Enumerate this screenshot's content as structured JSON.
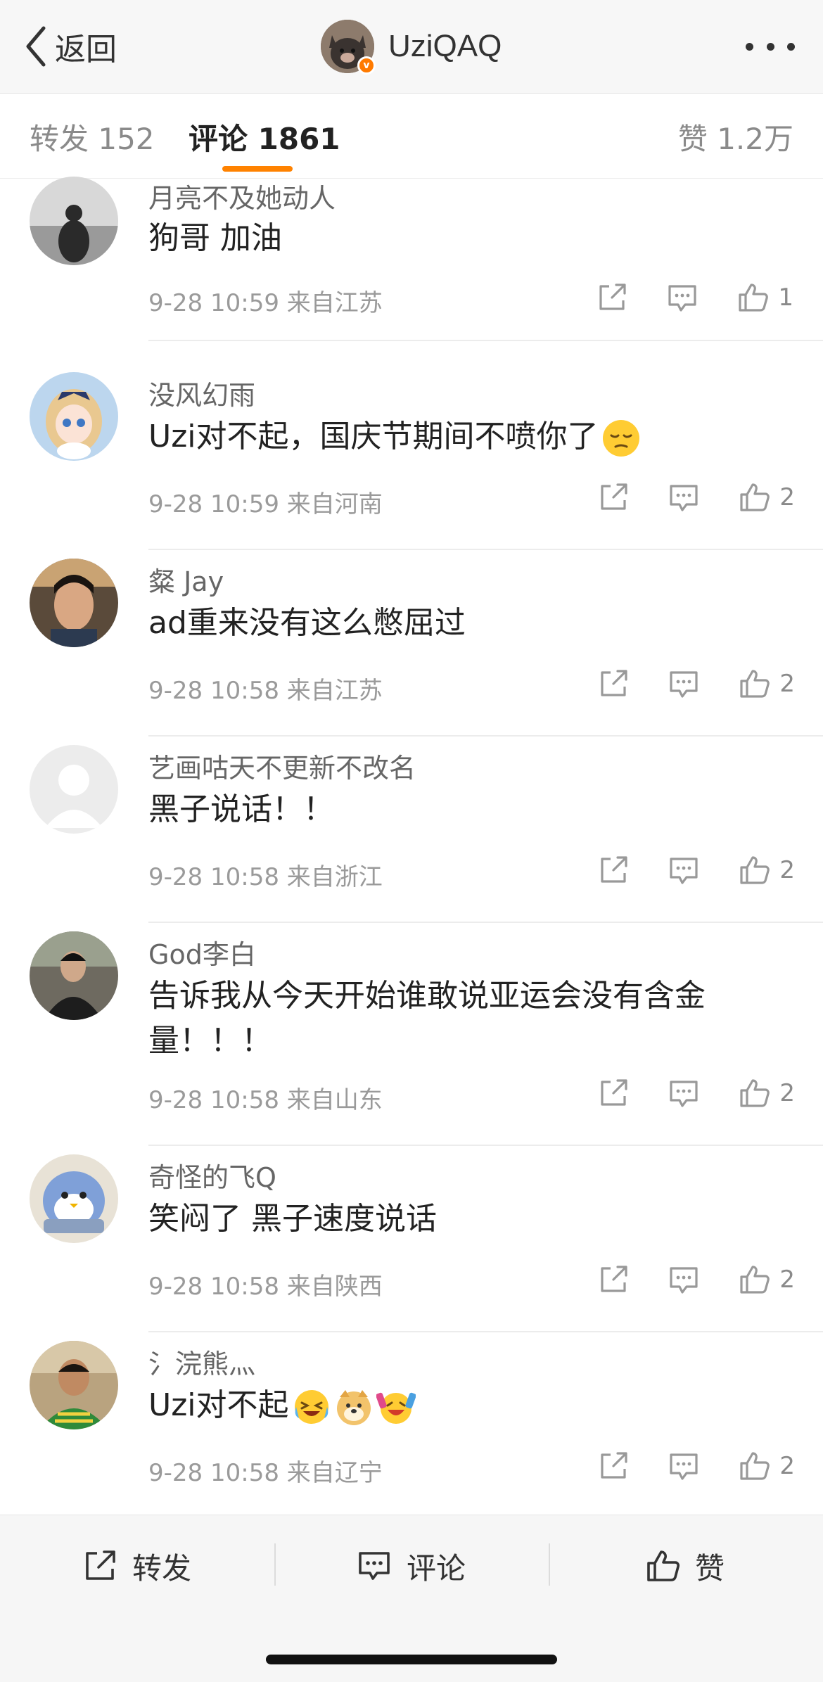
{
  "header": {
    "back_label": "返回",
    "title": "UziQAQ",
    "verified_badge": "v"
  },
  "tabs": {
    "repost": "转发 152",
    "comment": "评论 1861",
    "like": "赞 1.2万",
    "active": "comment",
    "accent_color": "#ff8200"
  },
  "comments": [
    {
      "name": "月亮不及她动人",
      "text": "狗哥 加油",
      "time": "9-28 10:59",
      "location": "来自江苏",
      "likes": "1"
    },
    {
      "name": "没风幻雨",
      "text": "Uzi对不起，国庆节期间不喷你了",
      "emoji": [
        "pensive-face"
      ],
      "time": "9-28 10:59",
      "location": "来自河南",
      "likes": "2"
    },
    {
      "name": "粲 Jay",
      "text": "ad重来没有这么憋屈过",
      "time": "9-28 10:58",
      "location": "来自江苏",
      "likes": "2"
    },
    {
      "name": "艺画咕天不更新不改名",
      "text": "黑子说话！！",
      "time": "9-28 10:58",
      "location": "来自浙江",
      "likes": "2"
    },
    {
      "name": "God李白",
      "text": "告诉我从今天开始谁敢说亚运会没有含金量！！！",
      "time": "9-28 10:58",
      "location": "来自山东",
      "likes": "2"
    },
    {
      "name": "奇怪的飞Q",
      "text": "笑闷了 黑子速度说话",
      "time": "9-28 10:58",
      "location": "来自陕西",
      "likes": "2"
    },
    {
      "name": "氵浣熊灬",
      "text": "Uzi对不起",
      "emoji": [
        "laughing-crying-face",
        "doge-face",
        "grinning-party-face"
      ],
      "time": "9-28 10:58",
      "location": "来自辽宁",
      "likes": "2"
    }
  ],
  "bottom_bar": {
    "repost": "转发",
    "comment": "评论",
    "like": "赞"
  },
  "icons": [
    "back-chevron-icon",
    "more-dots-icon",
    "share-icon",
    "comment-icon",
    "thumbs-up-icon"
  ]
}
